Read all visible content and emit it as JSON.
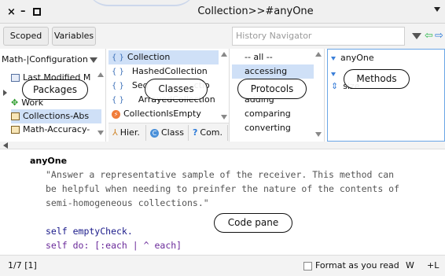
{
  "window": {
    "title": "Collection>>#anyOne",
    "close_icon": "×",
    "min_icon": "–"
  },
  "toolbar": {
    "scoped_label": "Scoped",
    "variables_label": "Variables",
    "history_placeholder": "History Navigator"
  },
  "packages": {
    "combo_value": "Math-|Configuration",
    "items": [
      {
        "label": "Last Modified M",
        "icon": "package-icon"
      },
      {
        "label": "Work",
        "icon": "work-icon"
      },
      {
        "label": "Collections-Abs",
        "icon": "package-icon"
      },
      {
        "label": "Math-Accuracy-",
        "icon": "package-icon"
      }
    ]
  },
  "classes": {
    "items": [
      {
        "label": "Collection",
        "selected": true
      },
      {
        "label": "HashedCollection"
      },
      {
        "label": "Seq"
      },
      {
        "label": "ctio"
      },
      {
        "label": "ArrayedCollection"
      },
      {
        "label": "CollectionIsEmpty"
      }
    ],
    "hier_label": "Hier.",
    "class_label": "Class",
    "com_label": "Com."
  },
  "protocols": {
    "items": [
      {
        "label": "-- all --"
      },
      {
        "label": "accessing",
        "selected": true
      },
      {
        "label": "adding"
      },
      {
        "label": "comparing"
      },
      {
        "label": "converting"
      }
    ]
  },
  "methods": {
    "items": [
      {
        "label": "anyOne"
      },
      {
        "label": "size"
      }
    ]
  },
  "code": {
    "selector": "anyOne",
    "comment_1": "\"Answer a representative sample of the receiver. This method can",
    "comment_2": "be helpful when needing to preinfer the nature of the contents of",
    "comment_3": "semi-homogeneous collections.\"",
    "line_1": "self emptyCheck.",
    "line_2": "self do: [:each | ^ each]"
  },
  "status": {
    "position": "1/7 [1]",
    "format_label": "Format as you read",
    "wrap_label": "W",
    "lines_label": "+L"
  },
  "annotations": {
    "packages": "Packages",
    "classes": "Classes",
    "protocols": "Protocols",
    "methods": "Methods",
    "code_pane": "Code pane"
  },
  "colors": {
    "selection": "#cfe0f7",
    "methods_border": "#6aa6e6",
    "nav_back": "#2db84d",
    "nav_forward": "#2a79d8"
  }
}
